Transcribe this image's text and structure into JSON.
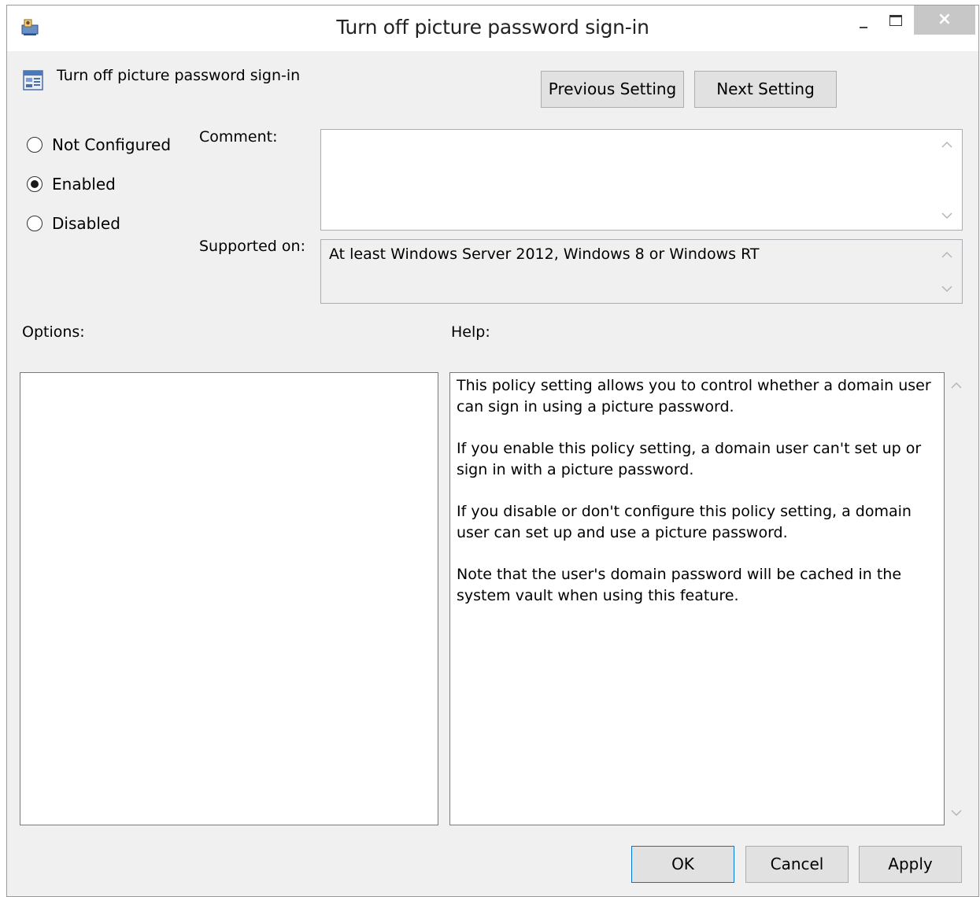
{
  "window": {
    "title": "Turn off picture password sign-in",
    "close_glyph": "×"
  },
  "header": {
    "setting_name": "Turn off picture password sign-in",
    "previous_label": "Previous Setting",
    "next_label": "Next Setting"
  },
  "state": {
    "options": [
      {
        "label": "Not Configured",
        "selected": false
      },
      {
        "label": "Enabled",
        "selected": true
      },
      {
        "label": "Disabled",
        "selected": false
      }
    ]
  },
  "comment": {
    "label": "Comment:",
    "value": ""
  },
  "supported": {
    "label": "Supported on:",
    "value": "At least Windows Server 2012, Windows 8 or Windows RT"
  },
  "options_panel": {
    "label": "Options:"
  },
  "help": {
    "label": "Help:",
    "paragraphs": [
      "This policy setting allows you to control whether a domain user can sign in using a picture password.",
      "If you enable this policy setting, a domain user can't set up or sign in with a picture password.",
      "If you disable or don't configure this policy setting, a domain user can set up and use a picture password.",
      "Note that the user's domain password will be cached in the system vault when using this feature."
    ]
  },
  "footer": {
    "ok_label": "OK",
    "cancel_label": "Cancel",
    "apply_label": "Apply"
  },
  "icons": {
    "window": "group-policy-app-icon",
    "setting": "policy-setting-icon",
    "scroll_up": "chevron-up-icon",
    "scroll_down": "chevron-down-icon"
  },
  "colors": {
    "accent": "#0078d7",
    "close_button": "#c7c7c7",
    "dialog_background": "#f0f0f0"
  }
}
